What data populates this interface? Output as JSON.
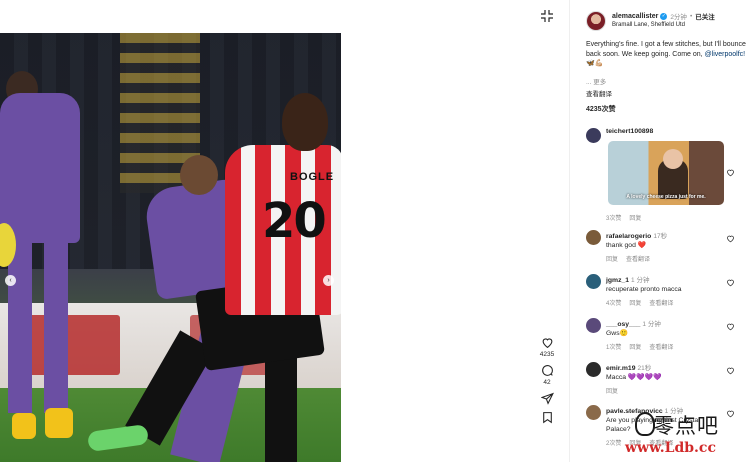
{
  "post": {
    "username": "alemacallister",
    "time": "2分钟",
    "follow_status": "已关注",
    "location": "Bramall Lane, Sheffield Utd",
    "caption_main": "Everything's fine. I got a few stitches, but I'll bounce back soon. We keep going. Come on, ",
    "caption_mention": "@liverpoolfc!",
    "caption_emoji": " 🦋💪🏼",
    "more_label": "... 更多",
    "translate_label": "查看翻译",
    "likes_label": "4235次赞"
  },
  "actions": {
    "like_count": "4235",
    "comment_count": "42"
  },
  "photo": {
    "player_number": "20",
    "player_name": "BOGLE"
  },
  "comments": [
    {
      "user": "teichert100898",
      "time": "",
      "text": "",
      "gif_caption": "A lovely cheese pizza just for me.",
      "likes": "3次赞",
      "reply": "回复",
      "translate": "",
      "avatar_color": "#3b3b5c"
    },
    {
      "user": "rafaelarogerio",
      "time": "17秒",
      "text": "thank god ",
      "emoji": "❤️",
      "likes": "",
      "reply": "回复",
      "translate": "查看翻译",
      "avatar_color": "#7a5b3a"
    },
    {
      "user": "jgmz_1",
      "time": "1 分钟",
      "text": "recuperate pronto macca",
      "emoji": "",
      "likes": "4次赞",
      "reply": "回复",
      "translate": "查看翻译",
      "avatar_color": "#2a5f7a"
    },
    {
      "user": "___osy___",
      "time": "1 分钟",
      "text": "Gws",
      "emoji": "🙂",
      "likes": "1次赞",
      "reply": "回复",
      "translate": "查看翻译",
      "avatar_color": "#5a4a7a"
    },
    {
      "user": "emir.m19",
      "time": "21秒",
      "text": "Macca ",
      "emoji": "💜💜💜💜",
      "likes": "",
      "reply": "回复",
      "translate": "",
      "avatar_color": "#2b2b2b"
    },
    {
      "user": "pavle.stefanovicc",
      "time": "1 分钟",
      "text": "Are you playing against Crystal Palace?",
      "emoji": "",
      "likes": "2次赞",
      "reply": "回复",
      "translate": "查看翻译",
      "avatar_color": "#8a6a4a"
    }
  ],
  "watermark": {
    "text_cn": "零点吧",
    "url": "www.Ldb.cc"
  },
  "colors": {
    "mention": "#00376b",
    "verified": "#1d9bf0",
    "secondary_text": "#8e8e8e"
  }
}
